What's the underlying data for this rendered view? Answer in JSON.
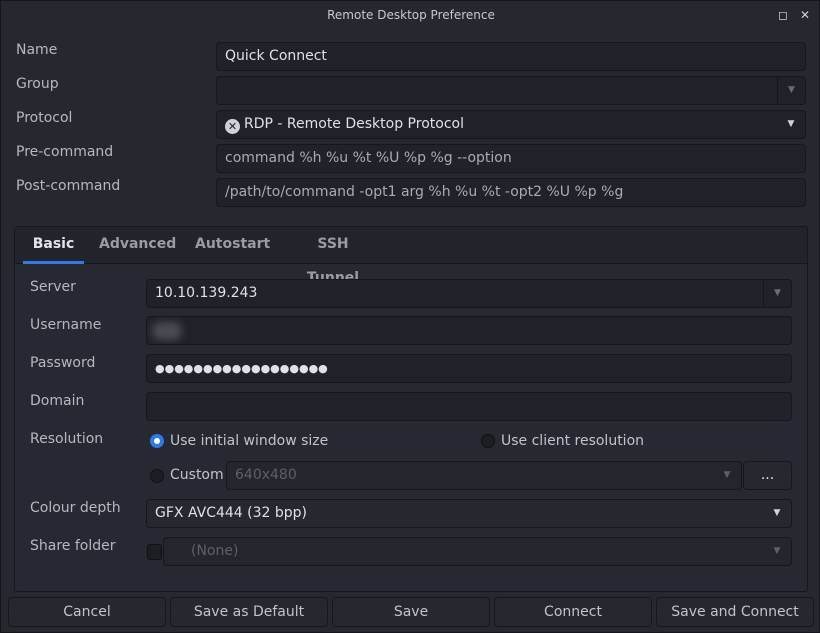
{
  "window": {
    "title": "Remote Desktop Preference",
    "maximize_icon": "square-icon",
    "close_icon": "x-icon",
    "maximize_glyph": "◻",
    "close_glyph": "✕"
  },
  "form": {
    "name": {
      "label": "Name",
      "value": "Quick Connect"
    },
    "group": {
      "label": "Group",
      "value": ""
    },
    "protocol": {
      "label": "Protocol",
      "value": "RDP - Remote Desktop Protocol",
      "icon": "rdp-protocol-icon"
    },
    "precommand": {
      "label": "Pre-command",
      "placeholder": "command %h %u %t %U %p %g --option"
    },
    "postcommand": {
      "label": "Post-command",
      "placeholder": "/path/to/command -opt1 arg %h %u %t -opt2 %U %p %g"
    }
  },
  "tabs": [
    {
      "label": "Basic",
      "active": true
    },
    {
      "label": "Advanced"
    },
    {
      "label": "Autostart"
    },
    {
      "label": "SSH Tunnel"
    }
  ],
  "basic": {
    "server": {
      "label": "Server",
      "value": "10.10.139.243"
    },
    "username": {
      "label": "Username",
      "value": ""
    },
    "password": {
      "label": "Password",
      "value": "●●●●●●●●●●●●●●●●●●"
    },
    "domain": {
      "label": "Domain",
      "value": ""
    },
    "resolution": {
      "label": "Resolution",
      "options": [
        "Use initial window size",
        "Use client resolution",
        "Custom"
      ],
      "selected": "Use initial window size",
      "custom_value": "640x480",
      "more_button": "..."
    },
    "colour_depth": {
      "label": "Colour depth",
      "value": "GFX AVC444 (32 bpp)"
    },
    "share_folder": {
      "label": "Share folder",
      "checked": false,
      "value": "(None)"
    }
  },
  "buttons": {
    "cancel": "Cancel",
    "save_default": "Save as Default",
    "save": "Save",
    "connect": "Connect",
    "save_connect": "Save and Connect"
  },
  "colors": {
    "accent": "#2f7ae5",
    "background": "#262830"
  }
}
